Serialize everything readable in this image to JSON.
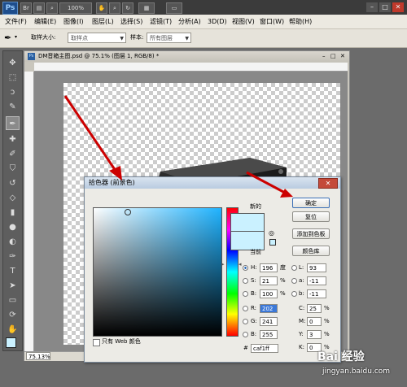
{
  "app": {
    "logo": "Ps",
    "zoom_readout": "100%"
  },
  "menus": [
    "文件(F)",
    "编辑(E)",
    "图像(I)",
    "图层(L)",
    "选择(S)",
    "滤镜(T)",
    "分析(A)",
    "3D(D)",
    "视图(V)",
    "窗口(W)",
    "帮助(H)"
  ],
  "options": {
    "sample_size_label": "取样大小:",
    "sample_size_value": "取样点",
    "sample_label": "样本:",
    "sample_value": "所有图层"
  },
  "document": {
    "title": "DM音箱主图.psd @ 75.1% (图层 1, RGB/8) *",
    "status_zoom": "75.13%"
  },
  "dialog": {
    "title": "拾色器 (前景色)",
    "ok": "确定",
    "reset": "复位",
    "add_swatch": "添加到色板",
    "color_library": "颜色库",
    "new_label": "新的",
    "current_label": "当前",
    "web_only": "只有 Web 颜色",
    "hsb": [
      {
        "label": "H:",
        "value": "196",
        "unit": "度"
      },
      {
        "label": "S:",
        "value": "21",
        "unit": "%"
      },
      {
        "label": "B:",
        "value": "100",
        "unit": "%"
      }
    ],
    "lab": [
      {
        "label": "L:",
        "value": "93"
      },
      {
        "label": "a:",
        "value": "-11"
      },
      {
        "label": "b:",
        "value": "-11"
      }
    ],
    "rgb": [
      {
        "label": "R:",
        "value": "202"
      },
      {
        "label": "G:",
        "value": "241"
      },
      {
        "label": "B:",
        "value": "255"
      }
    ],
    "cmyk": [
      {
        "label": "C:",
        "value": "25",
        "unit": "%"
      },
      {
        "label": "M:",
        "value": "0",
        "unit": "%"
      },
      {
        "label": "Y:",
        "value": "3",
        "unit": "%"
      },
      {
        "label": "K:",
        "value": "0",
        "unit": "%"
      }
    ],
    "hex_label": "#",
    "hex": "caf1ff",
    "color": "#caf1ff"
  },
  "watermark": {
    "logo": "Bai 经验",
    "url": "jingyan.baidu.com"
  }
}
